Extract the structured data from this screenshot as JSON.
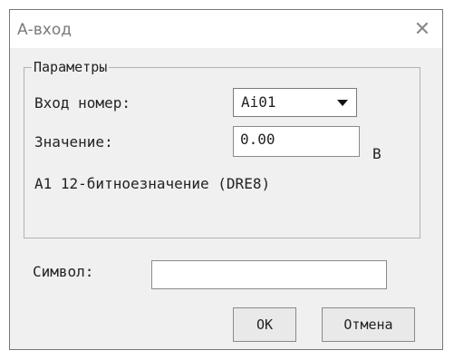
{
  "window": {
    "title": "А-вход"
  },
  "group": {
    "legend": "Параметры"
  },
  "input_number": {
    "label": "Вход номер:",
    "value": "Ai01"
  },
  "value_field": {
    "label": "Значение:",
    "value": "0.00",
    "unit": "В"
  },
  "description": "A1 12-битноезначение (DRE8)",
  "symbol": {
    "label": "Символ:",
    "value": ""
  },
  "buttons": {
    "ok": "OK",
    "cancel": "Отмена"
  },
  "icons": {
    "close": "close-icon",
    "dropdown": "chevron-down-icon"
  }
}
